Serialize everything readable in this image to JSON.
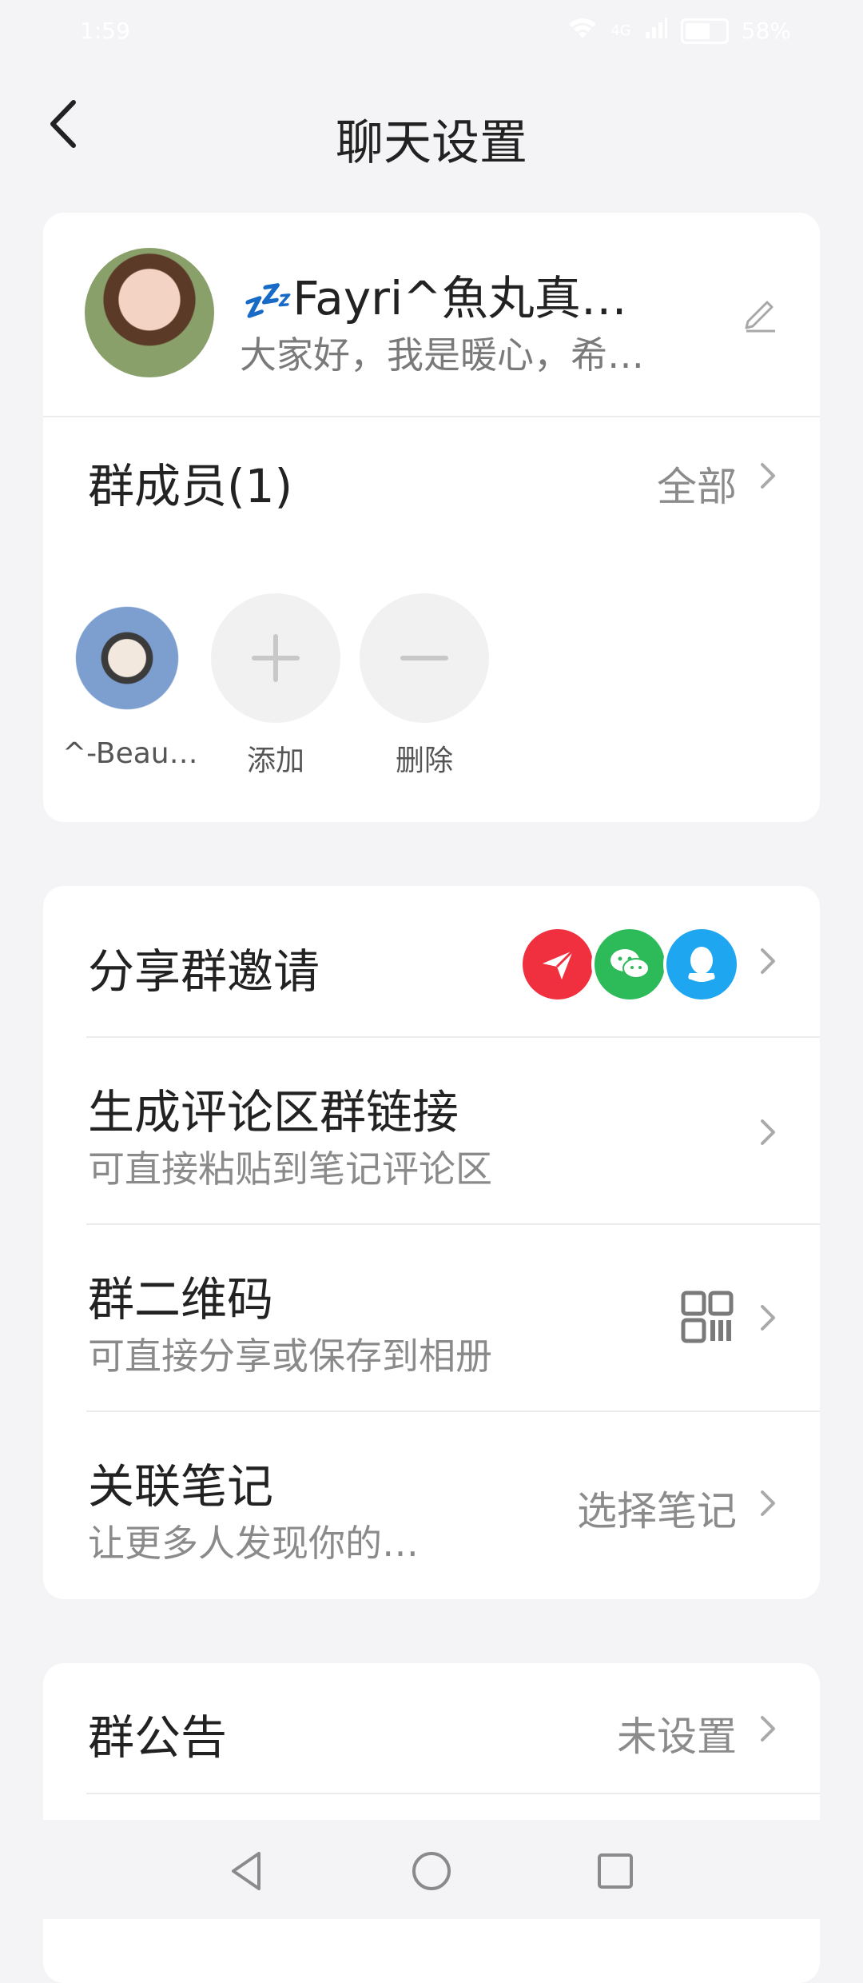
{
  "status_bar": {
    "time": "1:59",
    "network": "4G",
    "battery": "58%"
  },
  "header": {
    "title": "聊天设置"
  },
  "group": {
    "name_prefix": "💤",
    "name": "Fayri^魚丸真…",
    "description": "大家好，我是暖心，希…"
  },
  "members": {
    "title": "群成员(1)",
    "all_label": "全部",
    "items": [
      {
        "label": "^-Beau…"
      },
      {
        "label": "添加"
      },
      {
        "label": "删除"
      }
    ]
  },
  "actions": {
    "share_invite": {
      "title": "分享群邀请",
      "icons": [
        "send-icon",
        "wechat-icon",
        "qq-icon"
      ]
    },
    "comment_link": {
      "title": "生成评论区群链接",
      "sub": "可直接粘贴到笔记评论区"
    },
    "qr_code": {
      "title": "群二维码",
      "sub": "可直接分享或保存到相册"
    },
    "linked_notes": {
      "title": "关联笔记",
      "sub": "让更多人发现你的…",
      "value": "选择笔记"
    }
  },
  "notice": {
    "title": "群公告",
    "value": "未设置"
  },
  "colors": {
    "send": "#f0303f",
    "wechat": "#2dbb5a",
    "qq": "#1ea7f0",
    "zzz": "#4aa1f0"
  }
}
